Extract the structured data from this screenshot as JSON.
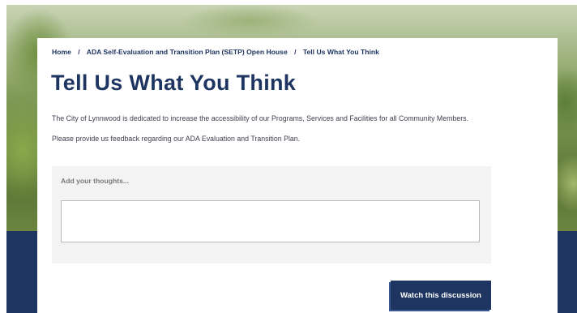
{
  "breadcrumb": {
    "items": [
      "Home",
      "ADA Self-Evaluation and Transition Plan (SETP) Open House",
      "Tell Us What You Think"
    ],
    "separator": "/"
  },
  "page": {
    "title": "Tell Us What You Think",
    "intro_1": "The City of Lynnwood is dedicated to increase the accessibility of our Programs, Services and Facilities for all Community Members.",
    "intro_2": "Please provide us feedback regarding our ADA Evaluation and Transition Plan."
  },
  "comment": {
    "label": "Add your thoughts...",
    "value": ""
  },
  "watch_button": {
    "label": "Watch this discussion"
  },
  "colors": {
    "brand_navy": "#1f3561",
    "panel_gray": "#f3f3f3"
  }
}
